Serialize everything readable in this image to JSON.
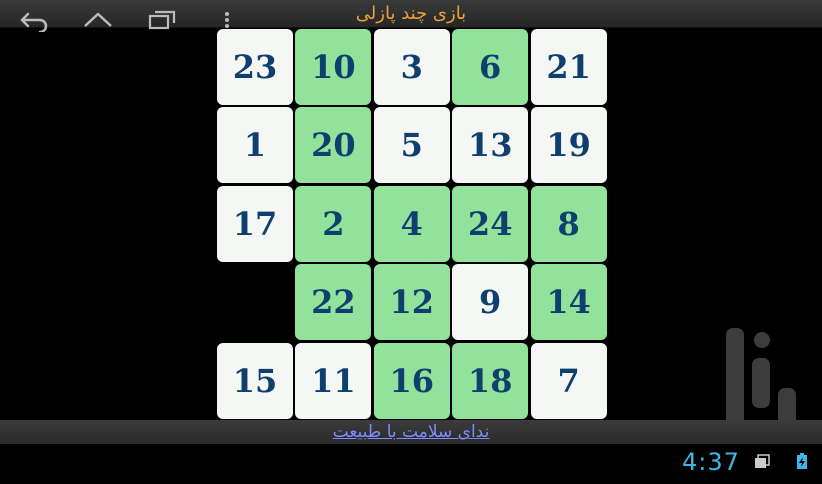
{
  "app": {
    "title": "بازی چند پازلی",
    "footer_link": "ندای سلامت با طبیعت"
  },
  "board": {
    "rows": 5,
    "cols": 5,
    "empty": [
      3,
      0
    ],
    "tiles": [
      [
        {
          "n": "23",
          "c": "white"
        },
        {
          "n": "10",
          "c": "green"
        },
        {
          "n": "3",
          "c": "white"
        },
        {
          "n": "6",
          "c": "green"
        },
        {
          "n": "21",
          "c": "white"
        }
      ],
      [
        {
          "n": "1",
          "c": "white"
        },
        {
          "n": "20",
          "c": "green"
        },
        {
          "n": "5",
          "c": "white"
        },
        {
          "n": "13",
          "c": "white"
        },
        {
          "n": "19",
          "c": "white"
        }
      ],
      [
        {
          "n": "17",
          "c": "white"
        },
        {
          "n": "2",
          "c": "green"
        },
        {
          "n": "4",
          "c": "green"
        },
        {
          "n": "24",
          "c": "green"
        },
        {
          "n": "8",
          "c": "green"
        }
      ],
      [
        null,
        {
          "n": "22",
          "c": "green"
        },
        {
          "n": "12",
          "c": "green"
        },
        {
          "n": "9",
          "c": "white"
        },
        {
          "n": "14",
          "c": "green"
        }
      ],
      [
        {
          "n": "15",
          "c": "white"
        },
        {
          "n": "11",
          "c": "white"
        },
        {
          "n": "16",
          "c": "green"
        },
        {
          "n": "18",
          "c": "green"
        },
        {
          "n": "7",
          "c": "white"
        }
      ]
    ],
    "colors": {
      "white": "#f5f7f5",
      "green": "#92e29c",
      "number": "#0f3f6e"
    }
  },
  "status": {
    "time": "4:37",
    "icons": [
      "screenshot-icon",
      "battery-charging-icon"
    ]
  },
  "nav": {
    "icons": [
      "back-icon",
      "home-icon",
      "recent-apps-icon",
      "menu-icon"
    ]
  },
  "colors": {
    "clock": "#3fb5e8",
    "title": "#e8a233",
    "link": "#7b8cff"
  }
}
